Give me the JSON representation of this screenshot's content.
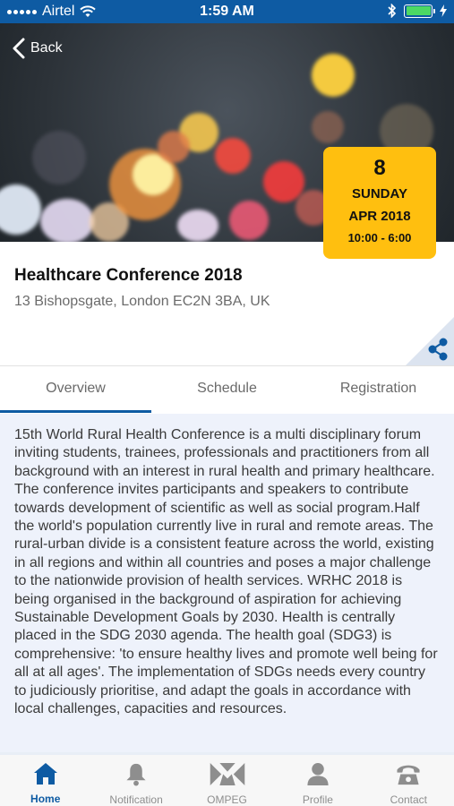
{
  "status_bar": {
    "carrier": "Airtel",
    "time": "1:59 AM"
  },
  "header": {
    "back_label": "Back"
  },
  "date_box": {
    "day": "8",
    "weekday": "SUNDAY",
    "month_year": "APR 2018",
    "hours": "10:00 - 6:00"
  },
  "event": {
    "title": "Healthcare Conference 2018",
    "address": "13 Bishopsgate, London EC2N 3BA, UK"
  },
  "tabs": [
    {
      "label": "Overview",
      "active": true
    },
    {
      "label": "Schedule",
      "active": false
    },
    {
      "label": "Registration",
      "active": false
    }
  ],
  "overview_text": "15th World Rural Health Conference is a multi disciplinary forum inviting students, trainees, professionals and practitioners from all background with an interest in rural health and primary healthcare. The conference invites participants and speakers to contribute towards development of scientific as well as social program.Half the world's population currently live in rural and remote areas. The rural-urban divide is a consistent feature across the world, existing in all regions and within all countries and poses a major challenge to the nationwide provision of health services. WRHC 2018 is being organised in the background of aspiration for achieving Sustainable Development Goals by 2030. Health is centrally placed in the SDG 2030 agenda. The health goal (SDG3) is comprehensive: 'to ensure healthy lives and promote well being for all at all ages'. The implementation of SDGs needs every country to judiciously prioritise, and adapt the goals in accordance with local challenges, capacities and resources.",
  "bottom_nav": [
    {
      "label": "Home",
      "icon": "home-icon",
      "active": true
    },
    {
      "label": "Notification",
      "icon": "bell-icon",
      "active": false
    },
    {
      "label": "OMPEG",
      "icon": "ompeg-logo-icon",
      "active": false
    },
    {
      "label": "Profile",
      "icon": "profile-icon",
      "active": false
    },
    {
      "label": "Contact",
      "icon": "phone-icon",
      "active": false
    }
  ],
  "colors": {
    "primary": "#0e5ba3",
    "accent": "#ffbf0f",
    "content_bg": "#eef2fb"
  }
}
